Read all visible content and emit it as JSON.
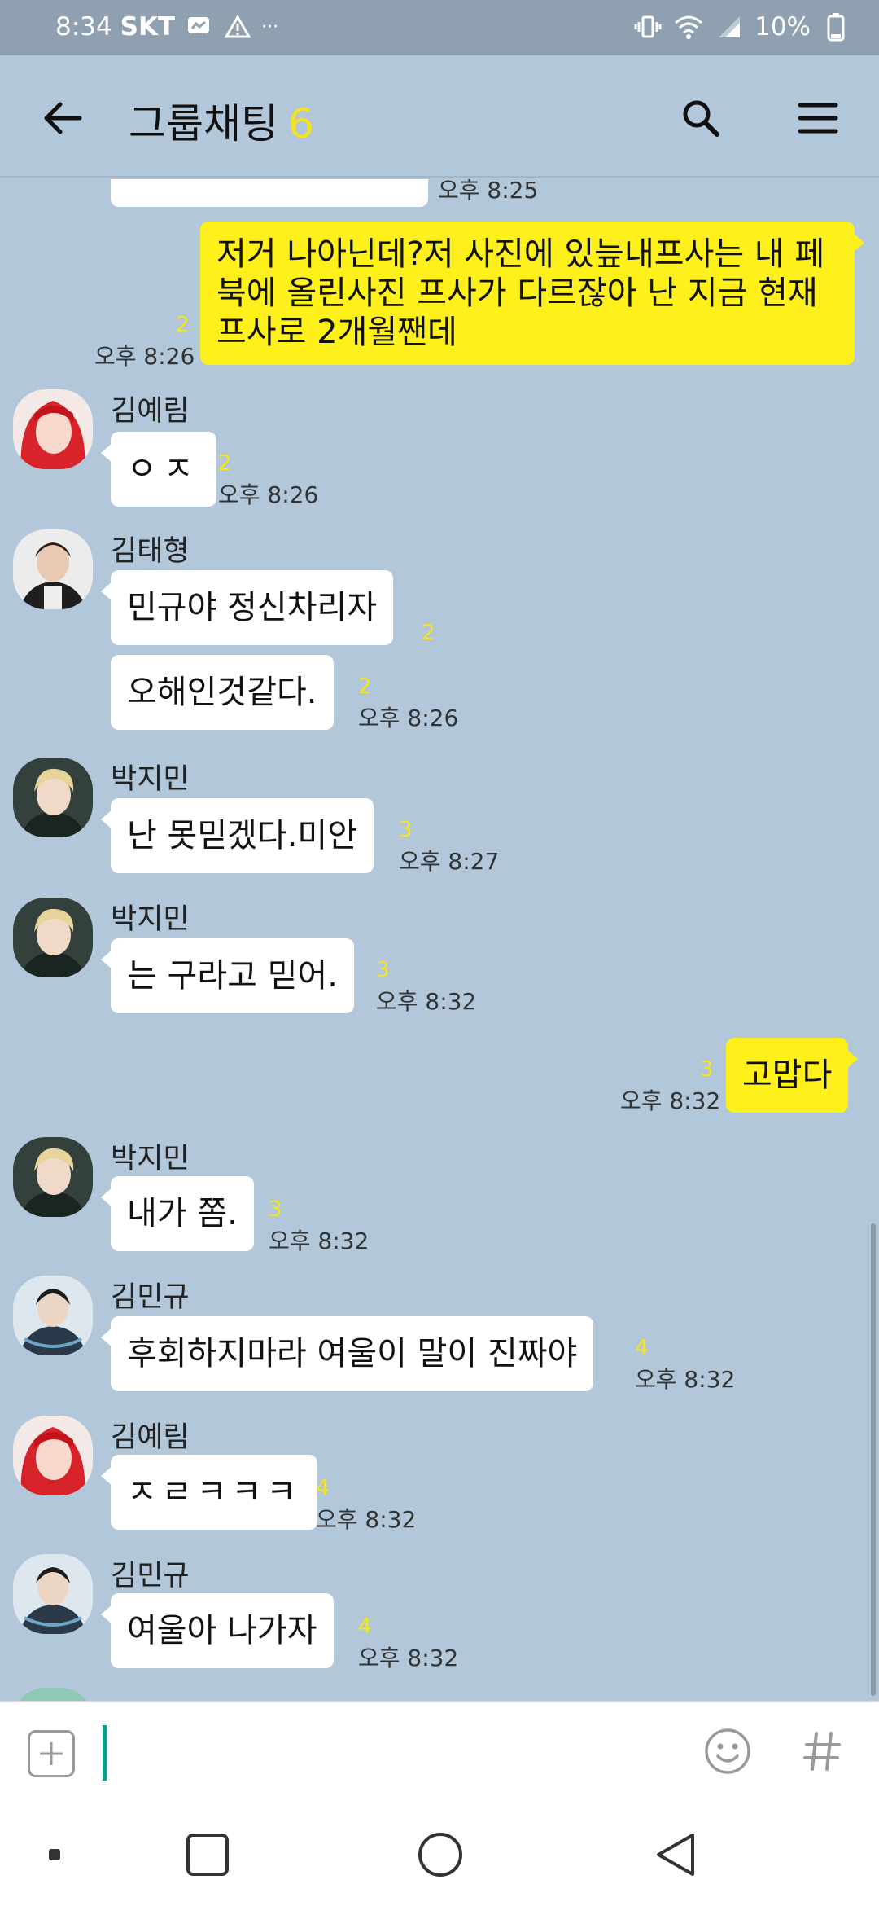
{
  "status_bar": {
    "time": "8:34",
    "carrier": "SKT",
    "dots": "···",
    "battery": "10%"
  },
  "header": {
    "title": "그룹채팅",
    "member_count": "6"
  },
  "messages": {
    "top_cutoff": {
      "time": "오후 8:25"
    },
    "m1": {
      "text": "저거 나아닌데?저 사진에 있늪내프사는 내 페북에 올린사진 프사가 다르잖아 난 지금 현재프사로 2개월짼데",
      "unread": "2",
      "time": "오후 8:26"
    },
    "m2": {
      "sender": "김예림",
      "text": "ㅇㅈ",
      "unread": "2",
      "time": "오후 8:26"
    },
    "m3": {
      "sender": "김태형",
      "text": "민규야 정신차리자",
      "unread": "2"
    },
    "m4": {
      "text": "오해인것같다.",
      "unread": "2",
      "time": "오후 8:26"
    },
    "m5": {
      "sender": "박지민",
      "text": "난 못믿겠다.미안",
      "unread": "3",
      "time": "오후 8:27"
    },
    "m6": {
      "sender": "박지민",
      "text": "는 구라고 믿어.",
      "unread": "3",
      "time": "오후 8:32"
    },
    "m7": {
      "text": "고맙다",
      "unread": "3",
      "time": "오후 8:32"
    },
    "m8": {
      "sender": "박지민",
      "text": "내가 쫌.",
      "unread": "3",
      "time": "오후 8:32"
    },
    "m9": {
      "sender": "김민규",
      "text": "후회하지마라 여울이 말이 진짜야",
      "unread": "4",
      "time": "오후 8:32"
    },
    "m10": {
      "sender": "김예림",
      "text": "ㅈㄹㅋㅋㅋ",
      "unread": "4",
      "time": "오후 8:32"
    },
    "m11": {
      "sender": "김민규",
      "text": "여울아 나가자",
      "unread": "4",
      "time": "오후 8:32"
    }
  },
  "colors": {
    "background": "#b2c7d9",
    "my_bubble": "#fef01b",
    "unread": "#f5e41c",
    "caret": "#0d9b86"
  },
  "icons": {
    "back": "arrow-left-icon",
    "search": "search-icon",
    "menu": "hamburger-icon",
    "plus": "plus-icon",
    "emoji": "emoji-icon",
    "hash": "hash-icon"
  }
}
